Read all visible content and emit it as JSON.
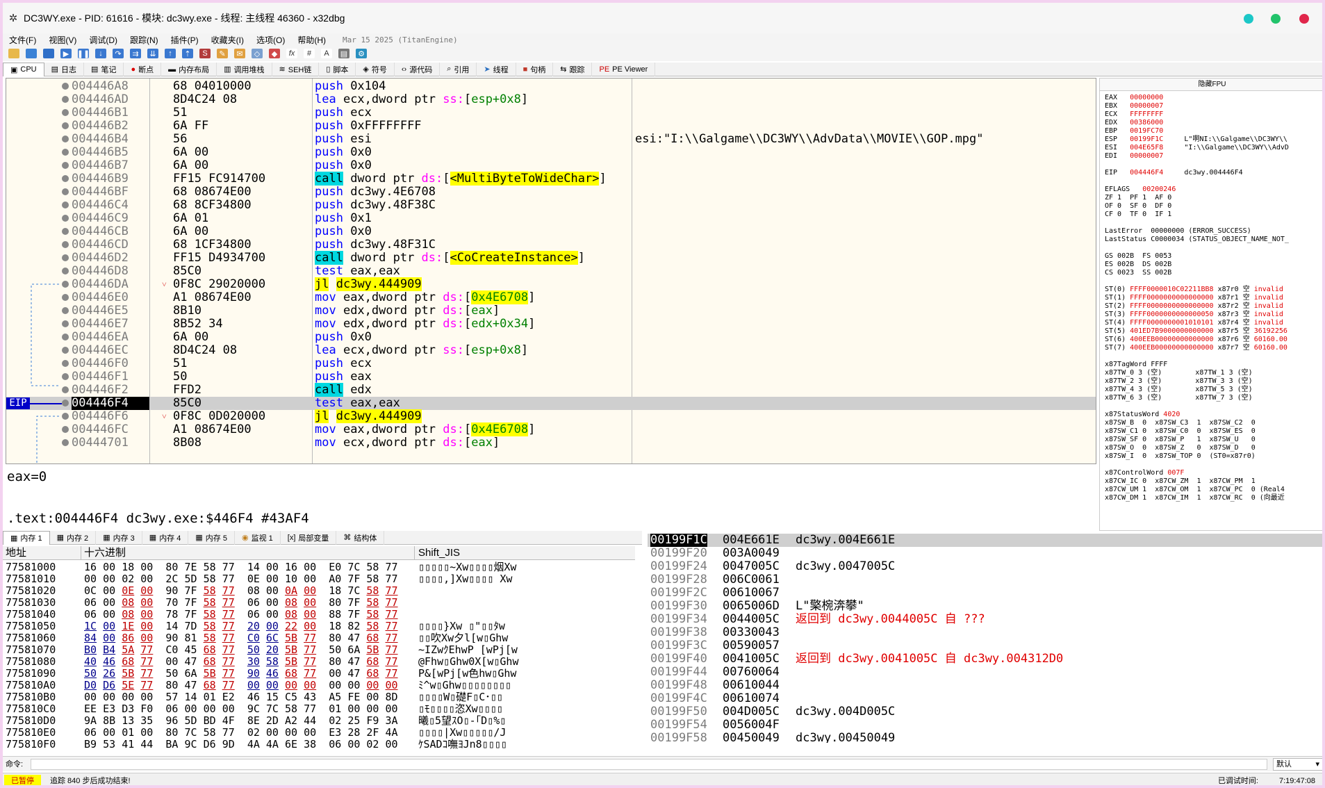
{
  "window": {
    "title": "DC3WY.exe - PID: 61616 - 模块: dc3wy.exe - 线程: 主线程 46360 - x32dbg"
  },
  "menu": {
    "items": [
      "文件(F)",
      "视图(V)",
      "调试(D)",
      "跟踪(N)",
      "插件(P)",
      "收藏夹(I)",
      "选项(O)",
      "帮助(H)"
    ],
    "date": "Mar 15 2025 (TitanEngine)"
  },
  "tabs": [
    {
      "icon": "cpu-icon",
      "label": "CPU"
    },
    {
      "icon": "log-icon",
      "label": "日志"
    },
    {
      "icon": "notes-icon",
      "label": "笔记"
    },
    {
      "icon": "breakpoint-icon",
      "label": "断点"
    },
    {
      "icon": "memory-map-icon",
      "label": "内存布局"
    },
    {
      "icon": "call-stack-icon",
      "label": "调用堆栈"
    },
    {
      "icon": "seh-icon",
      "label": "SEH链"
    },
    {
      "icon": "script-icon",
      "label": "脚本"
    },
    {
      "icon": "symbol-icon",
      "label": "符号"
    },
    {
      "icon": "source-icon",
      "label": "源代码"
    },
    {
      "icon": "references-icon",
      "label": "引用"
    },
    {
      "icon": "threads-icon",
      "label": "线程"
    },
    {
      "icon": "handles-icon",
      "label": "句柄"
    },
    {
      "icon": "trace-icon",
      "label": "跟踪"
    },
    {
      "icon": "pe-viewer-icon",
      "label": "PE Viewer"
    }
  ],
  "disasm": {
    "eip_label": "EIP",
    "rows": [
      {
        "addr": "004446A8",
        "hex": "68 04010000",
        "asm": "push 0x104"
      },
      {
        "addr": "004446AD",
        "hex": "8D4C24 08",
        "asm": "lea ecx,dword ptr ss:[esp+0x8]"
      },
      {
        "addr": "004446B1",
        "hex": "51",
        "asm": "push ecx"
      },
      {
        "addr": "004446B2",
        "hex": "6A FF",
        "asm": "push 0xFFFFFFFF"
      },
      {
        "addr": "004446B4",
        "hex": "56",
        "asm": "push esi",
        "cmt": "esi:\"I:\\\\Galgame\\\\DC3WY\\\\AdvData\\\\MOVIE\\\\GOP.mpg\""
      },
      {
        "addr": "004446B5",
        "hex": "6A 00",
        "asm": "push 0x0"
      },
      {
        "addr": "004446B7",
        "hex": "6A 00",
        "asm": "push 0x0"
      },
      {
        "addr": "004446B9",
        "hex": "FF15 FC914700",
        "asm": "call dword ptr ds:[<MultiByteToWideChar>]"
      },
      {
        "addr": "004446BF",
        "hex": "68 08674E00",
        "asm": "push dc3wy.4E6708"
      },
      {
        "addr": "004446C4",
        "hex": "68 8CF34800",
        "asm": "push dc3wy.48F38C"
      },
      {
        "addr": "004446C9",
        "hex": "6A 01",
        "asm": "push 0x1"
      },
      {
        "addr": "004446CB",
        "hex": "6A 00",
        "asm": "push 0x0"
      },
      {
        "addr": "004446CD",
        "hex": "68 1CF34800",
        "asm": "push dc3wy.48F31C"
      },
      {
        "addr": "004446D2",
        "hex": "FF15 D4934700",
        "asm": "call dword ptr ds:[<CoCreateInstance>]"
      },
      {
        "addr": "004446D8",
        "hex": "85C0",
        "asm": "test eax,eax"
      },
      {
        "addr": "004446DA",
        "hex": "0F8C 29020000",
        "asm": "jl dc3wy.444909",
        "jmp": "˅"
      },
      {
        "addr": "004446E0",
        "hex": "A1 08674E00",
        "asm": "mov eax,dword ptr ds:[0x4E6708]"
      },
      {
        "addr": "004446E5",
        "hex": "8B10",
        "asm": "mov edx,dword ptr ds:[eax]"
      },
      {
        "addr": "004446E7",
        "hex": "8B52 34",
        "asm": "mov edx,dword ptr ds:[edx+0x34]"
      },
      {
        "addr": "004446EA",
        "hex": "6A 00",
        "asm": "push 0x0"
      },
      {
        "addr": "004446EC",
        "hex": "8D4C24 08",
        "asm": "lea ecx,dword ptr ss:[esp+0x8]"
      },
      {
        "addr": "004446F0",
        "hex": "51",
        "asm": "push ecx"
      },
      {
        "addr": "004446F1",
        "hex": "50",
        "asm": "push eax"
      },
      {
        "addr": "004446F2",
        "hex": "FFD2",
        "asm": "call edx"
      },
      {
        "addr": "004446F4",
        "hex": "85C0",
        "asm": "test eax,eax",
        "cur": true
      },
      {
        "addr": "004446F6",
        "hex": "0F8C 0D020000",
        "asm": "jl dc3wy.444909",
        "jmp": "˅"
      },
      {
        "addr": "004446FC",
        "hex": "A1 08674E00",
        "asm": "mov eax,dword ptr ds:[0x4E6708]"
      },
      {
        "addr": "00444701",
        "hex": "8B08",
        "asm": "mov ecx,dword ptr ds:[eax]"
      }
    ]
  },
  "info": {
    "line1": "eax=0",
    "line2": ".text:004446F4 dc3wy.exe:$446F4 #43AF4"
  },
  "registers": {
    "title": "隐藏FPU",
    "lines": [
      "EAX   00000000",
      "EBX   00000007",
      "ECX   FFFFFFFF",
      "EDX   00386000",
      "EBP   0019FC70",
      "ESP   00199F1C     L\"啊NI:\\\\Galgame\\\\DC3WY\\\\",
      "ESI   004E65F8     \"I:\\\\Galgame\\\\DC3WY\\\\AdvD",
      "EDI   00000007",
      "",
      "EIP   004446F4     dc3wy.004446F4",
      "",
      "EFLAGS   00200246",
      "ZF 1  PF 1  AF 0",
      "OF 0  SF 0  DF 0",
      "CF 0  TF 0  IF 1",
      "",
      "LastError  00000000 (ERROR_SUCCESS)",
      "LastStatus C0000034 (STATUS_OBJECT_NAME_NOT_",
      "",
      "GS 002B  FS 0053",
      "ES 002B  DS 002B",
      "CS 0023  SS 002B",
      "",
      "ST(0) FFFF0000010C02211BB8 x87r0 空 invalid",
      "ST(1) FFFF0000000000000000 x87r1 空 invalid",
      "ST(2) FFFF0000000000000000 x87r2 空 invalid",
      "ST(3) FFFF0000000000000050 x87r3 空 invalid",
      "ST(4) FFFF0000000001010101 x87r4 空 invalid",
      "ST(5) 401ED7B9000000000000 x87r5 空 36192256",
      "ST(6) 400EEB00000000000000 x87r6 空 60160.00",
      "ST(7) 400EEB00000000000000 x87r7 空 60160.00",
      "",
      "x87TagWord FFFF",
      "x87TW_0 3 (空)        x87TW_1 3 (空)",
      "x87TW_2 3 (空)        x87TW_3 3 (空)",
      "x87TW_4 3 (空)        x87TW_5 3 (空)",
      "x87TW_6 3 (空)        x87TW_7 3 (空)",
      "",
      "x87StatusWord 4020",
      "x87SW_B  0  x87SW_C3  1  x87SW_C2  0",
      "x87SW_C1 0  x87SW_C0  0  x87SW_ES  0",
      "x87SW_SF 0  x87SW_P   1  x87SW_U   0",
      "x87SW_O  0  x87SW_Z   0  x87SW_D   0",
      "x87SW_I  0  x87SW_TOP 0  (ST0=x87r0)",
      "",
      "x87ControlWord 007F",
      "x87CW_IC 0  x87CW_ZM  1  x87CW_PM  1",
      "x87CW_UM 1  x87CW_OM  1  x87CW_PC  0 (Real4",
      "x87CW_DM 1  x87CW_IM  1  x87CW_RC  0 (向最近"
    ]
  },
  "bottom_tabs": [
    "内存 1",
    "内存 2",
    "内存 3",
    "内存 4",
    "内存 5",
    "监视 1",
    "局部变量",
    "结构体"
  ],
  "dump": {
    "headers": {
      "addr": "地址",
      "hex": "十六进制",
      "text": "Shift_JIS"
    },
    "rows": [
      {
        "addr": "77581000",
        "hex": "16 00 18 00 80 7E 58 77 14 00 16 00 E0 7C 58 77",
        "text": "▯▯▯▯▯~Xw▯▯▯▯烟Xw"
      },
      {
        "addr": "77581010",
        "hex": "00 00 02 00 2C 5D 58 77 0E 00 10 00 A0 7F 58 77",
        "text": "▯▯▯▯,]Xw▯▯▯▯ Xw"
      },
      {
        "addr": "77581020",
        "hex": "0C 00 0E 00 90 7F 58 77 08 00 0A 00 18 7C 58 77",
        "text": ""
      },
      {
        "addr": "77581030",
        "hex": "06 00 08 00 70 7F 58 77 06 00 08 00 80 7F 58 77",
        "text": ""
      },
      {
        "addr": "77581040",
        "hex": "06 00 08 00 78 7F 58 77 06 00 08 00 88 7F 58 77",
        "text": ""
      },
      {
        "addr": "77581050",
        "hex": "1C 00 1E 00 14 7D 58 77 20 00 22 00 18 82 58 77",
        "text": "▯▯▯▯}Xw ▯\"▯▯ﾀw"
      },
      {
        "addr": "77581060",
        "hex": "84 00 86 00 90 81 58 77 C0 6C 5B 77 80 47 68 77",
        "text": "▯▯吹Xw夕l[w▯Ghw"
      },
      {
        "addr": "77581070",
        "hex": "B0 B4 5A 77 C0 45 68 77 50 20 5B 77 50 6A 5B 77",
        "text": "~IZwｸEhwP [wPj[w"
      },
      {
        "addr": "77581080",
        "hex": "40 46 68 77 00 47 68 77 30 58 5B 77 80 47 68 77",
        "text": "@Fhw▯Ghw0X[w▯Ghw"
      },
      {
        "addr": "77581090",
        "hex": "50 26 5B 77 50 6A 5B 77 90 46 68 77 00 47 68 77",
        "text": "P&[wPj[w色hw▯Ghw"
      },
      {
        "addr": "775810A0",
        "hex": "D0 D6 5E 77 80 47 68 77 00 00 00 00 00 00 00 00",
        "text": "ﾐ^w▯Ghw▯▯▯▯▯▯▯▯"
      },
      {
        "addr": "775810B0",
        "hex": "00 00 00 00 57 14 01 E2 46 15 C5 43 A5 FE 00 8D",
        "text": "▯▯▯▯W▯礎F▯C･▯▯"
      },
      {
        "addr": "775810C0",
        "hex": "EE E3 D3 F0 06 00 00 00 9C 7C 58 77 01 00 00 00",
        "text": "▯ﾓ▯▯▯▯恣Xw▯▯▯▯"
      },
      {
        "addr": "775810D0",
        "hex": "9A 8B 13 35 96 5D BD 4F 8E 2D A2 44 02 25 F9 3A",
        "text": "曦▯5望ｽO▯-｢D▯%▯"
      },
      {
        "addr": "775810E0",
        "hex": "06 00 01 00 80 7C 58 77 02 00 00 00 E3 28 2F 4A",
        "text": "▯▯▯▯|Xw▯▯▯▯▯/J"
      },
      {
        "addr": "775810F0",
        "hex": "B9 53 41 44 BA 9C D6 9D 4A 4A 6E 38 06 00 02 00",
        "text": "ｹSADｺ嘸ﾖJn8▯▯▯▯"
      }
    ]
  },
  "stack": {
    "rows": [
      {
        "addr": "00199F1C",
        "val": "004E661E",
        "cmt": "dc3wy.004E661E",
        "top": true
      },
      {
        "addr": "00199F20",
        "val": "003A0049",
        "cmt": ""
      },
      {
        "addr": "00199F24",
        "val": "0047005C",
        "cmt": "dc3wy.0047005C"
      },
      {
        "addr": "00199F28",
        "val": "006C0061",
        "cmt": ""
      },
      {
        "addr": "00199F2C",
        "val": "00610067",
        "cmt": ""
      },
      {
        "addr": "00199F30",
        "val": "0065006D",
        "cmt": "L\"檠椀渀攀\""
      },
      {
        "addr": "00199F34",
        "val": "0044005C",
        "cmt": "返回到 dc3wy.0044005C 自 ???",
        "red": true
      },
      {
        "addr": "00199F38",
        "val": "00330043",
        "cmt": ""
      },
      {
        "addr": "00199F3C",
        "val": "00590057",
        "cmt": ""
      },
      {
        "addr": "00199F40",
        "val": "0041005C",
        "cmt": "返回到 dc3wy.0041005C 自 dc3wy.004312D0",
        "red": true
      },
      {
        "addr": "00199F44",
        "val": "00760064",
        "cmt": ""
      },
      {
        "addr": "00199F48",
        "val": "00610044",
        "cmt": ""
      },
      {
        "addr": "00199F4C",
        "val": "00610074",
        "cmt": ""
      },
      {
        "addr": "00199F50",
        "val": "004D005C",
        "cmt": "dc3wy.004D005C"
      },
      {
        "addr": "00199F54",
        "val": "0056004F",
        "cmt": ""
      },
      {
        "addr": "00199F58",
        "val": "00450049",
        "cmt": "dc3wy.00450049"
      }
    ]
  },
  "command": {
    "label": "命令:",
    "mode": "默认"
  },
  "status": {
    "state": "已暂停",
    "message": "追踪 840 步后成功结束!",
    "elapsed_label": "已调试时间:",
    "elapsed": "7:19:47:08"
  },
  "colors": {
    "eip": "#0000c8",
    "call_bg": "#00d8e0",
    "jump_bg": "#ffff00",
    "return_red": "#e00000"
  }
}
